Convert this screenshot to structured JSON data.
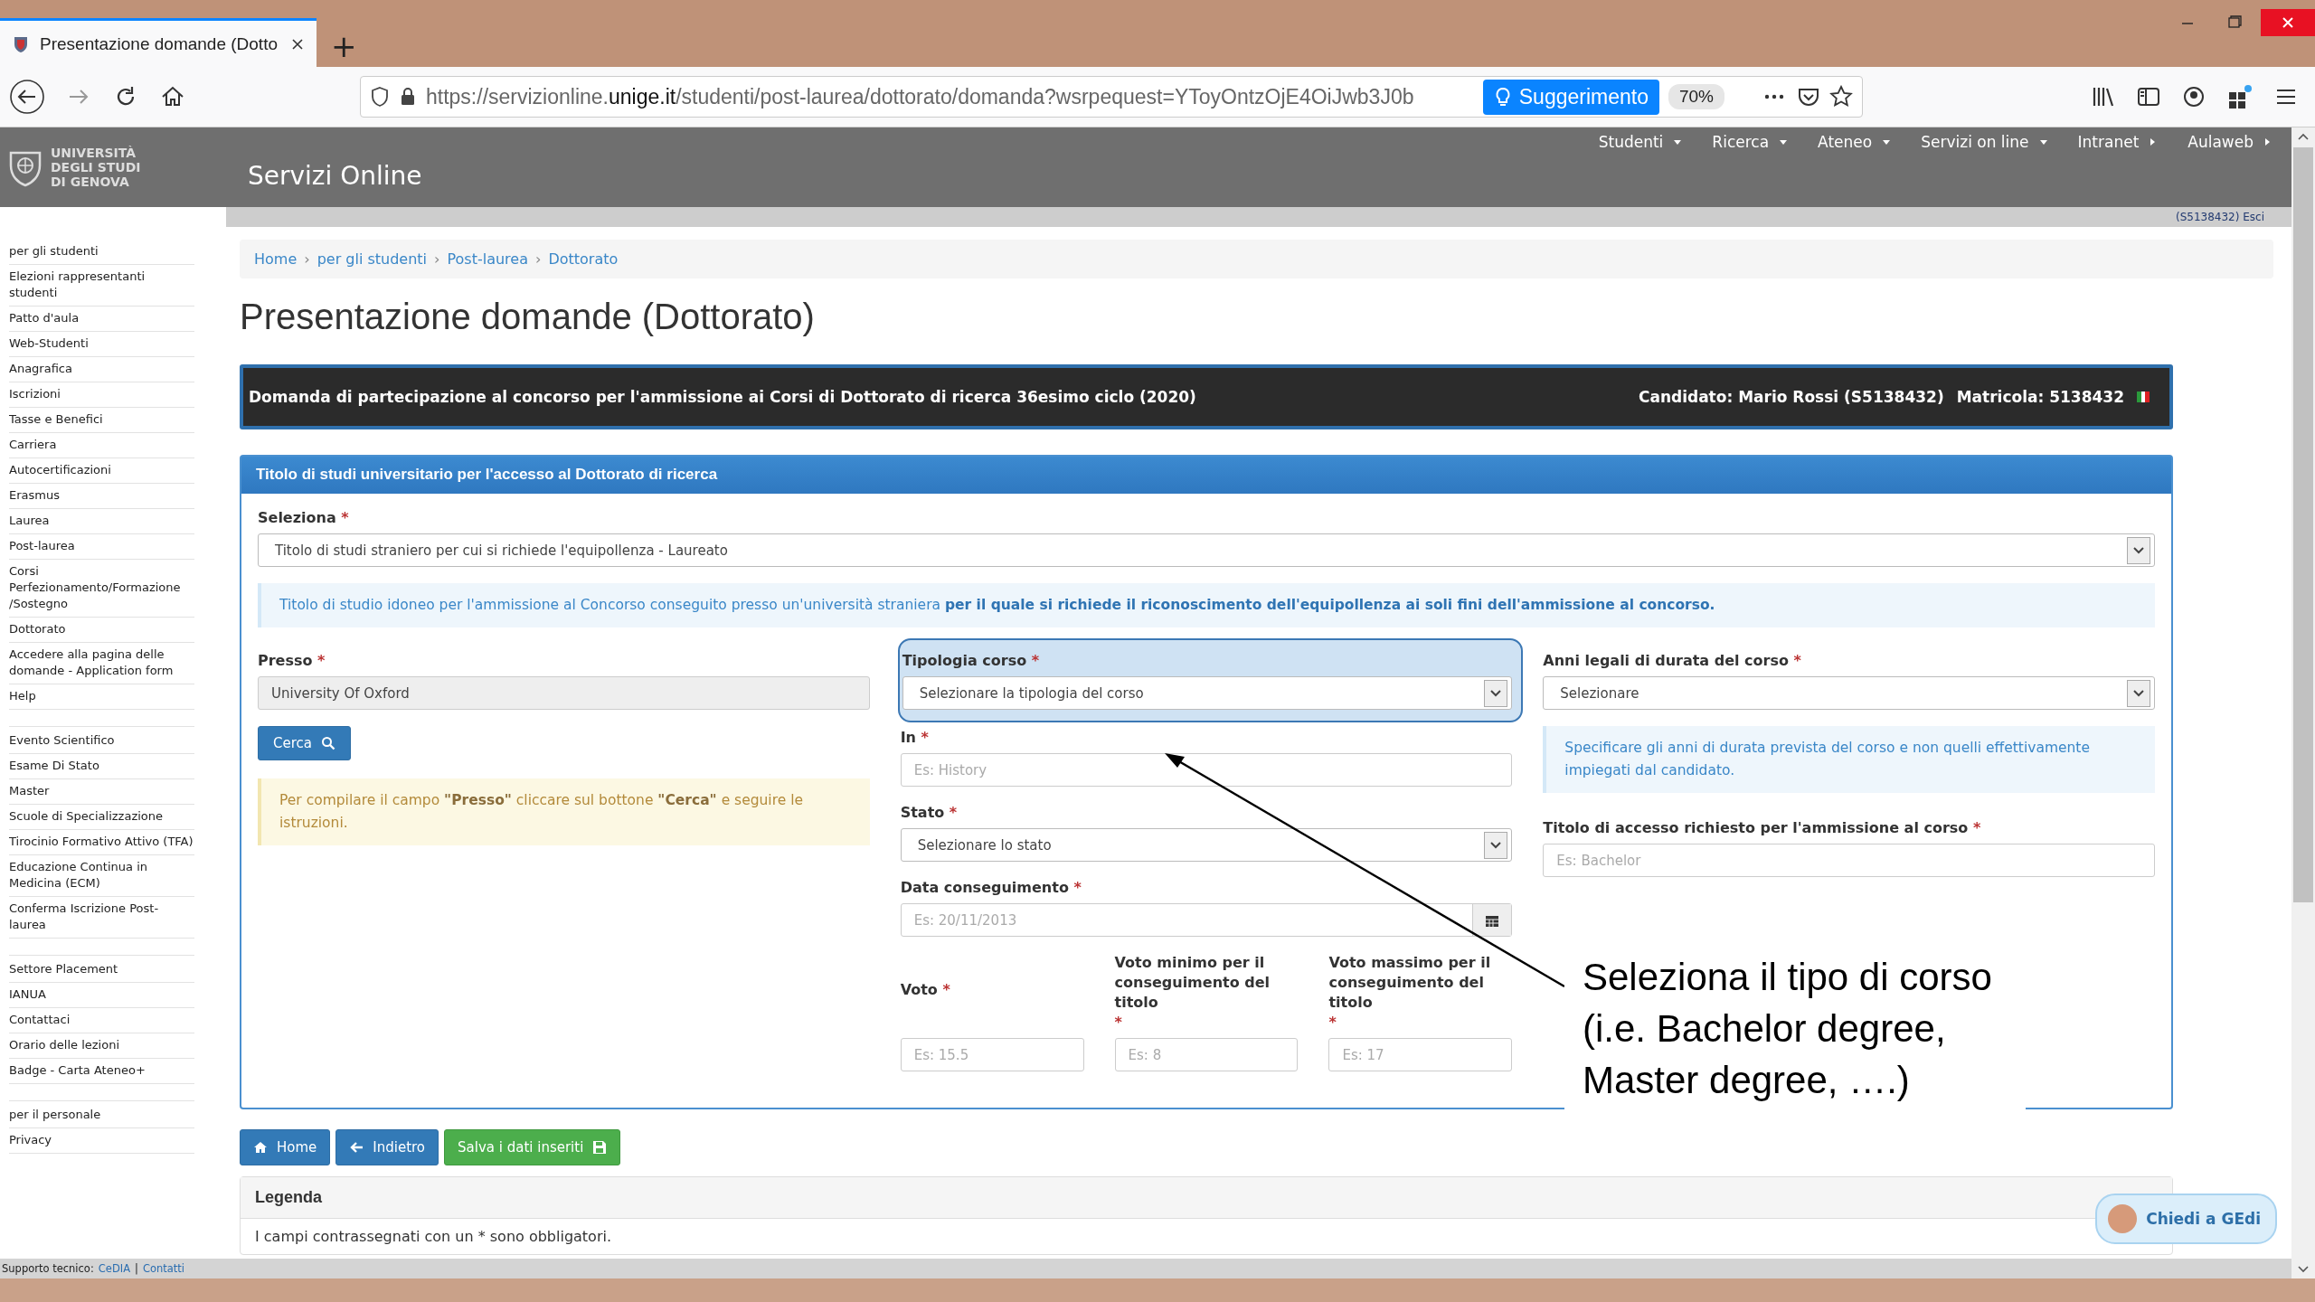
{
  "browser": {
    "tab": {
      "title": "Presentazione domande (Dotto",
      "selected": true
    },
    "new_tab": "+",
    "url": "https://servizionline.**unige.it**/studenti/post-laurea/dottorato/domanda?wsrpequest=YToyOntzOjE4OiJwb3J0b",
    "suggestion": "Suggerimento",
    "zoom": "70%"
  },
  "header": {
    "logo_text": "UNIVERSITÀ DEGLI STUDI DI GENOVA",
    "title": "Servizi Online",
    "menu": [
      {
        "label": "Studenti",
        "kind": "dropdown"
      },
      {
        "label": "Ricerca",
        "kind": "dropdown"
      },
      {
        "label": "Ateneo",
        "kind": "dropdown"
      },
      {
        "label": "Servizi on line",
        "kind": "dropdown"
      },
      {
        "label": "Intranet",
        "kind": "link"
      },
      {
        "label": "Aulaweb",
        "kind": "link"
      }
    ],
    "user": "(S5138432) Esci"
  },
  "sidebar": {
    "groups": [
      {
        "items": [
          "per gli studenti",
          "Elezioni rappresentanti studenti",
          "Patto d'aula",
          "Web-Studenti",
          "Anagrafica",
          "Iscrizioni",
          "Tasse e Benefici",
          "Carriera",
          "Autocertificazioni",
          "Erasmus",
          "Laurea",
          "Post-laurea",
          "Corsi Perfezionamento/Formazione /Sostegno",
          "Dottorato",
          "Accedere alla pagina delle domande - Application form",
          "Help"
        ]
      },
      {
        "items": [
          "Evento Scientifico",
          "Esame Di Stato",
          "Master",
          "Scuole di Specializzazione",
          "Tirocinio Formativo Attivo (TFA)",
          "Educazione Continua in Medicina (ECM)",
          "Conferma Iscrizione Post-laurea"
        ]
      },
      {
        "items": [
          "Settore Placement",
          "IANUA",
          "Contattaci",
          "Orario delle lezioni",
          "Badge - Carta Ateneo+"
        ]
      },
      {
        "items": [
          "per il personale",
          "Privacy"
        ]
      }
    ]
  },
  "breadcrumb": {
    "items": [
      "Home",
      "per gli studenti",
      "Post-laurea",
      "Dottorato"
    ],
    "separator": "›"
  },
  "page_title": "Presentazione domande (Dottorato)",
  "banner": {
    "text": "Domanda di partecipazione al concorso per l'ammissione ai Corsi di Dottorato di ricerca 36esimo ciclo (2020)",
    "candidate": "Candidato: Mario Rossi (S5138432)",
    "matricola": "Matricola: 5138432"
  },
  "panel": {
    "heading": "Titolo di studi universitario per l'accesso al Dottorato di ricerca",
    "select_field": {
      "kind": "select",
      "label": "Seleziona",
      "mark": "*",
      "value": "Titolo di studi straniero per cui si richiede l'equipollenza - Laureato",
      "highlighted": false
    },
    "info_note": "Titolo di studio idoneo per l'ammissione al Concorso conseguito presso un'università straniera **per il quale si richiede il riconoscimento dell'equipollenza ai soli fini dell'ammissione al concorso.**",
    "left_column": {
      "field": {
        "kind": "readonly",
        "label": "Presso",
        "mark": "*",
        "value": "University Of Oxford",
        "highlighted": false
      },
      "search_button": "Cerca",
      "warning": "Per compilare il campo **\"Presso\"** cliccare sul bottone **\"Cerca\"** e seguire le istruzioni."
    },
    "middle_column": {
      "fields": [
        {
          "kind": "select",
          "label": "Tipologia corso",
          "mark": "*",
          "value": "Selezionare la tipologia del corso",
          "highlighted": true
        },
        {
          "kind": "input",
          "label": "In",
          "mark": "*",
          "placeholder": "Es: History",
          "highlighted": false
        },
        {
          "kind": "select",
          "label": "Stato",
          "mark": "*",
          "value": "Selezionare lo stato",
          "highlighted": false
        },
        {
          "kind": "date",
          "label": "Data conseguimento",
          "mark": "*",
          "placeholder": "Es: 20/11/2013",
          "highlighted": false
        }
      ],
      "grade_fields": [
        {
          "kind": "input",
          "label": "Voto",
          "mark": "*",
          "placeholder": "Es: 15.5",
          "highlighted": false
        },
        {
          "kind": "input",
          "label": "Voto minimo per il conseguimento del titolo",
          "mark": "*",
          "placeholder": "Es: 8",
          "highlighted": false
        },
        {
          "kind": "input",
          "label": "Voto massimo per il conseguimento del titolo",
          "mark": "*",
          "placeholder": "Es: 17",
          "highlighted": false
        }
      ]
    },
    "right_column": {
      "fields": [
        {
          "kind": "select",
          "label": "Anni legali di durata del corso",
          "mark": "*",
          "value": "Selezionare",
          "highlighted": false
        },
        {
          "kind": "note",
          "text": "Specificare gli anni di durata prevista del corso e non quelli effettivamente impiegati dal candidato."
        },
        {
          "kind": "input",
          "label": "Titolo di accesso richiesto per l'ammissione al corso",
          "mark": "*",
          "placeholder": "Es: Bachelor",
          "highlighted": false
        }
      ]
    }
  },
  "buttons": [
    {
      "label": "Home",
      "kind": "home"
    },
    {
      "label": "Indietro",
      "kind": "back"
    },
    {
      "label": "Salva i dati inseriti",
      "kind": "save"
    }
  ],
  "legend": {
    "heading": "Legenda",
    "text": "I campi contrassegnati con un * sono obbligatori."
  },
  "footer": {
    "label": "Supporto tecnico:",
    "links": [
      "CeDIA",
      "Contatti"
    ],
    "separator": "|"
  },
  "chat_button": "Chiedi a GEdi",
  "annotation": "Seleziona il tipo di corso (i.e. Bachelor degree, Master degree, ….)"
}
